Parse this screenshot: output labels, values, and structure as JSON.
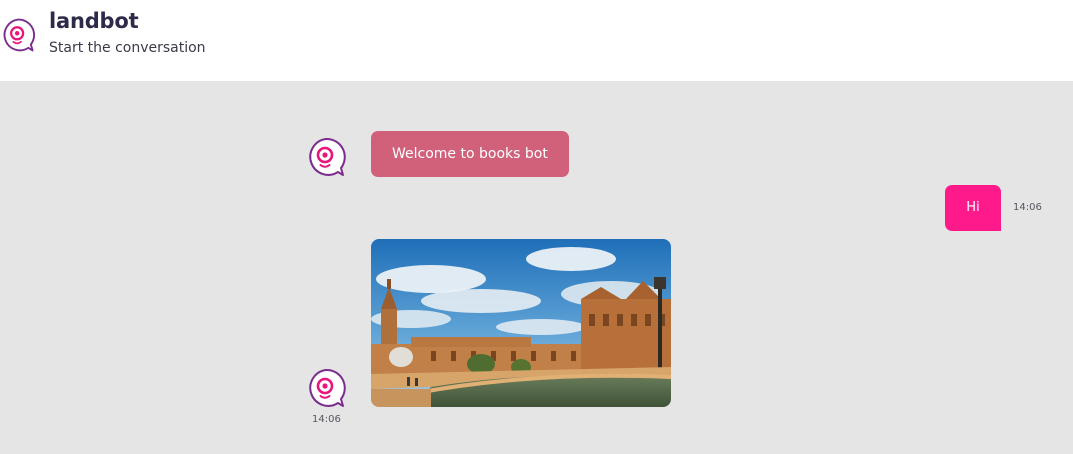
{
  "header": {
    "title": "landbot",
    "subtitle": "Start the conversation"
  },
  "messages": [
    {
      "sender": "bot",
      "text": "Welcome to books bot"
    },
    {
      "sender": "user",
      "text": "Hi",
      "time": "14:06"
    },
    {
      "sender": "bot",
      "type": "image",
      "time": "14:06"
    }
  ],
  "colors": {
    "bot_bubble": "#d1617b",
    "user_bubble": "#ff1a8c",
    "chat_background": "#e5e5e6",
    "logo_purple": "#7b2d8e",
    "logo_pink": "#e8157c"
  }
}
